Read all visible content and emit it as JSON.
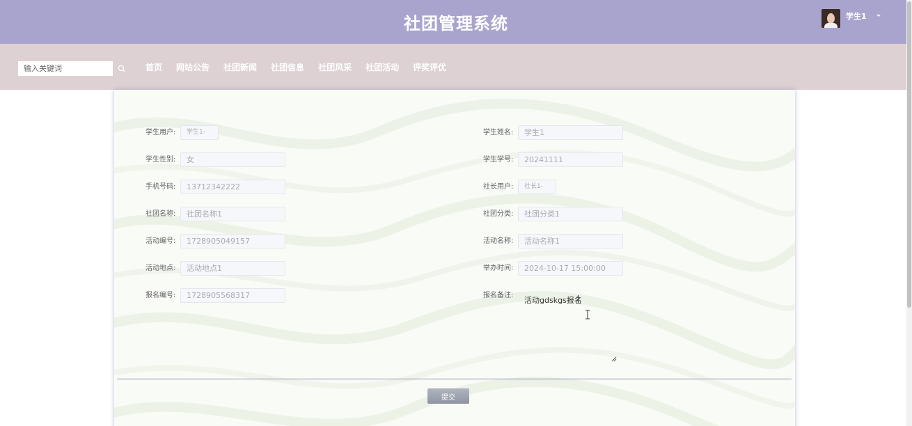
{
  "header": {
    "title": "社团管理系统",
    "user_name": "学生1"
  },
  "search": {
    "placeholder": "输入关键词"
  },
  "nav": {
    "items": [
      "首页",
      "网站公告",
      "社团新闻",
      "社团信息",
      "社团风采",
      "社团活动",
      "评奖评优"
    ]
  },
  "form": {
    "student_user": {
      "label": "学生用户:",
      "value": "学生1-"
    },
    "student_name": {
      "label": "学生姓名:",
      "value": "学生1"
    },
    "gender": {
      "label": "学生性别:",
      "value": "女"
    },
    "student_no": {
      "label": "学生学号:",
      "value": "20241111"
    },
    "phone": {
      "label": "手机号码:",
      "value": "13712342222"
    },
    "leader_user": {
      "label": "社长用户:",
      "value": "社长1-"
    },
    "club_name": {
      "label": "社团名称:",
      "value": "社团名称1"
    },
    "club_category": {
      "label": "社团分类:",
      "value": "社团分类1"
    },
    "activity_no": {
      "label": "活动编号:",
      "value": "1728905049157"
    },
    "activity_name": {
      "label": "活动名称:",
      "value": "活动名称1"
    },
    "activity_location": {
      "label": "活动地点:",
      "value": "活动地点1"
    },
    "event_time": {
      "label": "举办时间:",
      "value": "2024-10-17 15:00:00"
    },
    "signup_no": {
      "label": "报名编号:",
      "value": "1728905568317"
    },
    "remark": {
      "label": "报名备注:",
      "value": "活动gdskgs报名"
    },
    "submit_label": "提交"
  },
  "colors": {
    "header_bg": "#a9a4cd",
    "nav_bg": "#ddd1d3",
    "divider": "#8e8cb2"
  }
}
